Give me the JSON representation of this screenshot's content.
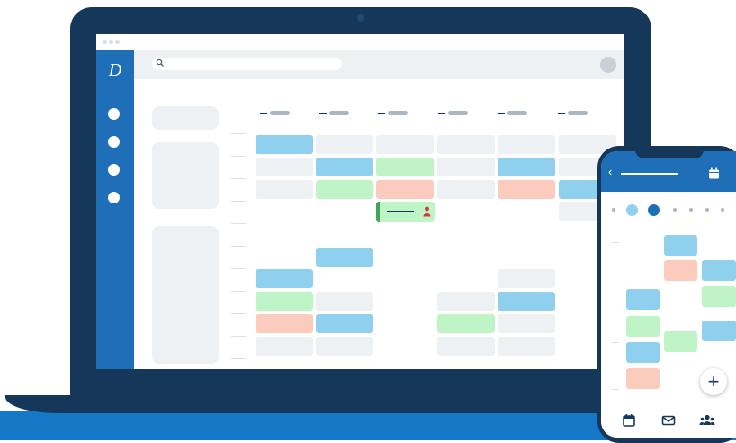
{
  "app": {
    "logo_text": "D"
  },
  "search": {
    "placeholder": ""
  },
  "sidebar": {
    "items": [
      "",
      "",
      "",
      ""
    ]
  },
  "calendar": {
    "days": [
      "",
      "",
      "",
      "",
      "",
      ""
    ],
    "legend": {
      "blue": "#8fd0ef",
      "green": "#bff5c6",
      "peach": "#fbcbbd",
      "gray": "#eef1f4"
    }
  },
  "colors": {
    "brand_dark": "#15375a",
    "brand_blue": "#1e6fb8",
    "band": "#1578c7"
  },
  "icons": [
    "search-icon",
    "person-icon",
    "calendar-icon",
    "mail-icon",
    "team-icon",
    "plus-icon",
    "back-chevron-icon"
  ],
  "phone": {
    "back_symbol": "‹",
    "fab_label": "+",
    "footer_tabs": [
      "calendar",
      "mail",
      "team"
    ]
  }
}
